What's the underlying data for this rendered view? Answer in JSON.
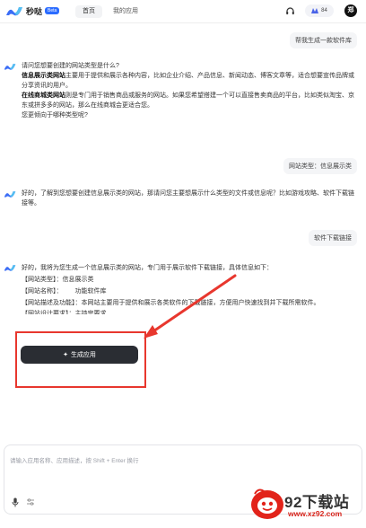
{
  "header": {
    "brand": "秒哒",
    "beta": "Beta",
    "tabs": [
      {
        "label": "首页"
      },
      {
        "label": "我的应用"
      }
    ],
    "points": "84",
    "avatar": "郑"
  },
  "messages": {
    "user1": "帮我生成一款软件库",
    "bot1": {
      "line1": "请问您想要创建的网站类型是什么?",
      "opt1_title": "信息展示类网站",
      "opt1_body": "主要用于提供和展示各种内容，比如企业介绍、产品信息、新闻动态、博客文章等，适合想要宣传品牌或分享资讯的用户。",
      "opt2_title": "在线商城类网站",
      "opt2_body": "则是专门用于销售商品或服务的网站。如果您希望搭建一个可以直接售卖商品的平台，比如类似淘宝、京东或拼多多的网站，那么在线商城会更适合您。",
      "question": "您更倾向于哪种类型呢?"
    },
    "user2": "网站类型：信息展示类",
    "bot2": "好的，了解到您想要创建信息展示类的网站，那请问您主要想展示什么类型的文件或信息呢？比如游戏攻略、软件下载链接等。",
    "user3": "软件下载链接",
    "bot3": {
      "intro": "好的，我将为您生成一个信息展示类的网站，专门用于展示软件下载链接，具体信息如下：",
      "type": "【网站类型】：信息展示类",
      "name": "【网站名称】：",
      "name_value": "功能软件库",
      "desc": "【网站描述及功能】：本网站主要用于提供和展示各类软件的下载链接，方便用户快速找到并下载所需软件。",
      "req": "【网站设计要求】：主持宗要求"
    },
    "generate_button": "生成应用"
  },
  "input": {
    "placeholder": "请输入应用名称、应用描述，按 Shift + Enter 换行"
  },
  "watermark": {
    "text": "92下载站",
    "url": "www.xz92.com"
  },
  "colors": {
    "accent": "#2b6cff",
    "button": "#2a2d33",
    "highlight_red": "#e8372e"
  }
}
